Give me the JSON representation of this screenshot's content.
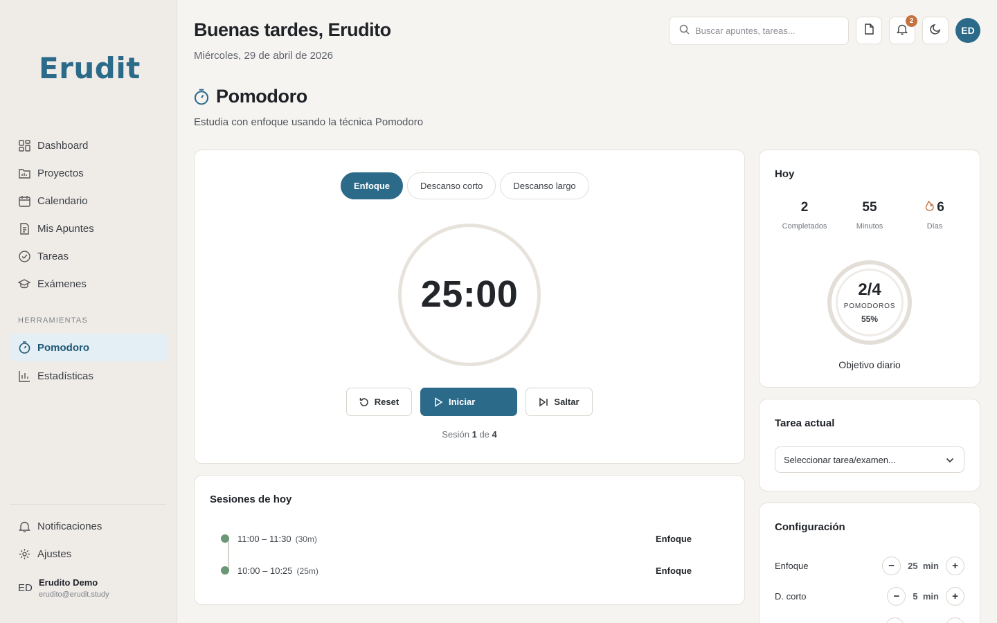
{
  "brand": {
    "logo": "Erudit"
  },
  "sidebar": {
    "items": [
      {
        "label": "Dashboard",
        "icon": "dashboard-icon"
      },
      {
        "label": "Proyectos",
        "icon": "folder-icon"
      },
      {
        "label": "Calendario",
        "icon": "calendar-icon"
      },
      {
        "label": "Mis Apuntes",
        "icon": "notes-icon"
      },
      {
        "label": "Tareas",
        "icon": "check-circle-icon"
      },
      {
        "label": "Exámenes",
        "icon": "graduation-cap-icon"
      }
    ],
    "tools_label": "HERRAMIENTAS",
    "tools": [
      {
        "label": "Pomodoro",
        "icon": "timer-icon",
        "active": true
      },
      {
        "label": "Estadísticas",
        "icon": "bar-chart-icon"
      }
    ],
    "bottom": [
      {
        "label": "Notificaciones",
        "icon": "bell-icon"
      },
      {
        "label": "Ajustes",
        "icon": "gear-icon"
      }
    ],
    "user": {
      "initials": "ED",
      "name": "Erudito Demo",
      "email": "erudito@erudit.study"
    }
  },
  "header": {
    "greeting": "Buenas tardes, Erudito",
    "date": "Miércoles, 29 de abril de 2026",
    "search_placeholder": "Buscar apuntes, tareas...",
    "notification_count": "2",
    "avatar_initials": "ED"
  },
  "page": {
    "title": "Pomodoro",
    "subtitle": "Estudia con enfoque usando la técnica Pomodoro"
  },
  "timer": {
    "modes": [
      "Enfoque",
      "Descanso corto",
      "Descanso largo"
    ],
    "active_mode": "Enfoque",
    "display": "25:00",
    "reset_label": "Reset",
    "start_label": "Iniciar",
    "skip_label": "Saltar",
    "session_prefix": "Sesión",
    "session_current": "1",
    "session_sep": "de",
    "session_total": "4"
  },
  "sessions": {
    "title": "Sesiones de hoy",
    "items": [
      {
        "time": "11:00 – 11:30",
        "duration": "(30m)",
        "type": "Enfoque"
      },
      {
        "time": "10:00 – 10:25",
        "duration": "(25m)",
        "type": "Enfoque"
      }
    ]
  },
  "today": {
    "title": "Hoy",
    "stats": [
      {
        "value": "2",
        "label": "Completados"
      },
      {
        "value": "55",
        "label": "Minutos"
      },
      {
        "value": "6",
        "label": "Días",
        "icon": "flame-icon"
      }
    ],
    "goal_value": "2/4",
    "goal_label": "POMODOROS",
    "goal_percent": "55%",
    "goal_caption": "Objetivo diario"
  },
  "current_task": {
    "title": "Tarea actual",
    "select_value": "Seleccionar tarea/examen..."
  },
  "config": {
    "title": "Configuración",
    "rows": [
      {
        "label": "Enfoque",
        "value": "25",
        "unit": "min"
      },
      {
        "label": "D. corto",
        "value": "5",
        "unit": "min"
      }
    ]
  },
  "colors": {
    "accent": "#2c6a8a",
    "accent_light": "#e3eff5",
    "badge": "#c4733f",
    "dot": "#6a9776"
  }
}
